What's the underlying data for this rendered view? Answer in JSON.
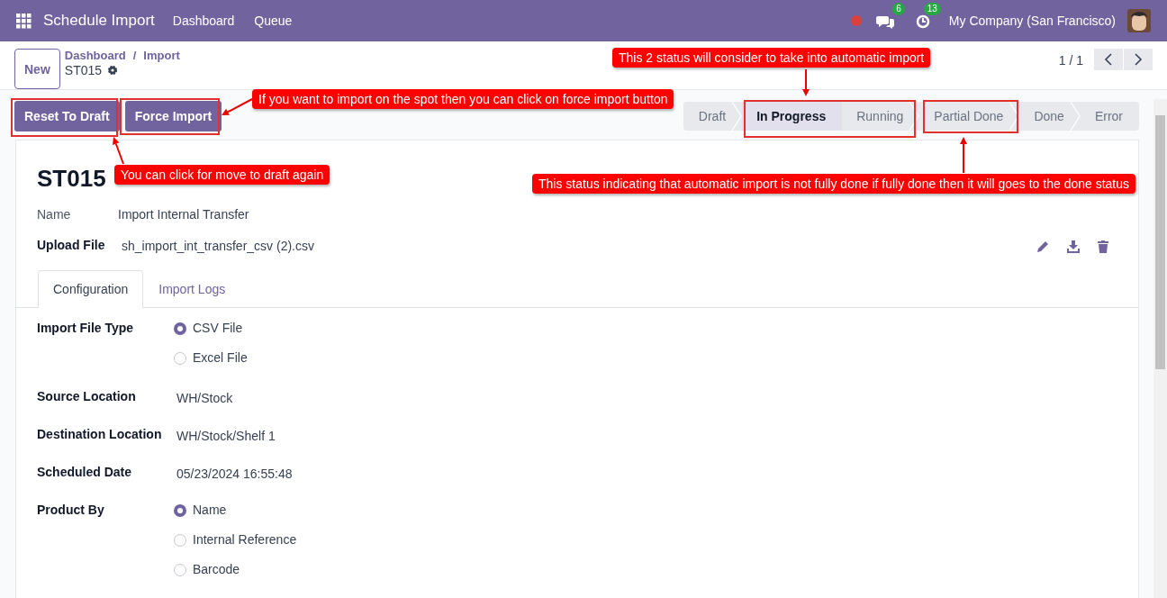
{
  "navbar": {
    "title": "Schedule Import",
    "menu": [
      "Dashboard",
      "Queue"
    ],
    "messages_count": "6",
    "activities_count": "13",
    "company": "My Company (San Francisco)"
  },
  "control_panel": {
    "new_button": "New",
    "breadcrumbs": [
      "Dashboard",
      "Import"
    ],
    "breadcrumb_separator": "/",
    "record": "ST015",
    "pager": "1 / 1"
  },
  "actions": [
    "Reset To Draft",
    "Force Import"
  ],
  "statusbar": [
    {
      "label": "Draft",
      "selected": false
    },
    {
      "label": "In Progress",
      "selected": true
    },
    {
      "label": "Running",
      "selected": false
    },
    {
      "label": "Partial Done",
      "selected": false
    },
    {
      "label": "Done",
      "selected": false
    },
    {
      "label": "Error",
      "selected": false
    }
  ],
  "sheet": {
    "title": "ST015",
    "name_label": "Name",
    "name_value": "Import Internal Transfer",
    "upload_label": "Upload File",
    "upload_value": "sh_import_int_transfer_csv (2).csv",
    "tabs": [
      {
        "label": "Configuration",
        "selected": true
      },
      {
        "label": "Import Logs",
        "selected": false
      }
    ],
    "fields": [
      {
        "kind": "radio",
        "label": "Import File Type",
        "options": [
          {
            "label": "CSV File",
            "selected": true
          },
          {
            "label": "Excel File",
            "selected": false
          }
        ]
      },
      {
        "kind": "text",
        "label": "Source Location",
        "value": "WH/Stock"
      },
      {
        "kind": "text",
        "label": "Destination Location",
        "value": "WH/Stock/Shelf 1"
      },
      {
        "kind": "text",
        "label": "Scheduled Date",
        "value": "05/23/2024 16:55:48"
      },
      {
        "kind": "radio",
        "label": "Product By",
        "options": [
          {
            "label": "Name",
            "selected": true
          },
          {
            "label": "Internal Reference",
            "selected": false
          },
          {
            "label": "Barcode",
            "selected": false
          }
        ]
      }
    ]
  },
  "annotations": [
    {
      "text": "If you want to import on the spot then you can click on force import button"
    },
    {
      "text": "This 2 status will consider to take into automatic import"
    },
    {
      "text": "You can click for move to draft again"
    },
    {
      "text": "This status indicating that automatic import is not fully done if fully done then it will goes to the done status"
    }
  ]
}
